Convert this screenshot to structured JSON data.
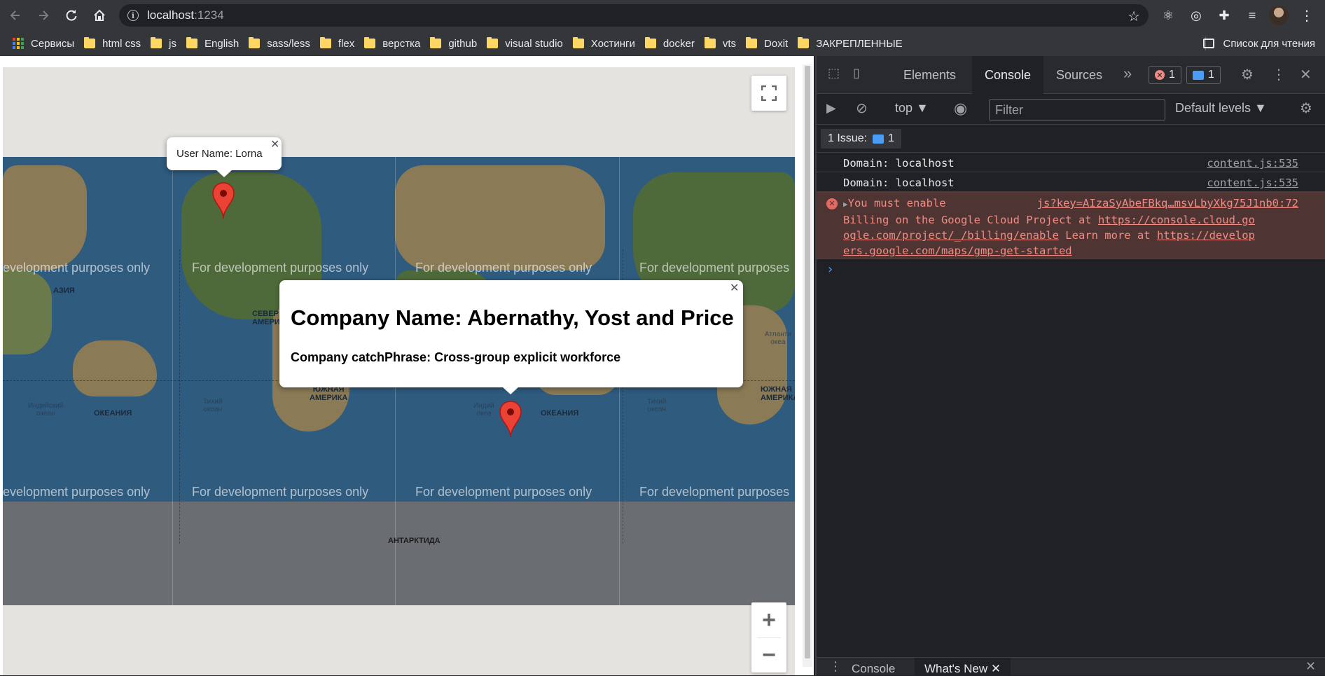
{
  "browser": {
    "url_host": "localhost",
    "url_port": ":1234",
    "bookmarks": [
      "Сервисы",
      "html css",
      "js",
      "English",
      "sass/less",
      "flex",
      "верстка",
      "github",
      "visual studio",
      "Хостинги",
      "docker",
      "vts",
      "Doxit",
      "ЗАКРЕПЛЕННЫЕ"
    ],
    "reading_list": "Список для чтения"
  },
  "map": {
    "watermark": "For development purposes only",
    "watermark_left_cut": "evelopment purposes only",
    "watermark_right_cut": "For development purposes",
    "labels": {
      "asia": "АЗИЯ",
      "north_america": "СЕВЕР\nАМЕРИ",
      "south_america": "ЮЖНАЯ\nАМЕРИКА",
      "south_america_right": "ЮЖНАЯ\nАМЕРИКА",
      "oceania_1": "ОКЕАНИЯ",
      "oceania_2": "ОКЕАНИЯ",
      "antarctica": "АНТАРКТИДА",
      "indian_ocean_1": "Индийский\nокеан",
      "indian_ocean_2": "Индий\nокеа",
      "pacific_1": "Тихий\nокеан",
      "pacific_2": "Тихий\nокеан",
      "atlantic": "Атланти\nокеа"
    },
    "infowindow_small": {
      "text": "User Name: Lorna",
      "close": "✕"
    },
    "infowindow_big": {
      "title": "Company Name: Abernathy, Yost and Price",
      "subtitle": "Company catchPhrase: Cross-group explicit workforce",
      "close": "✕"
    },
    "zoom_in": "+",
    "zoom_out": "−",
    "marker_color": "#ea4335"
  },
  "devtools": {
    "tabs": [
      "Elements",
      "Console",
      "Sources"
    ],
    "active_tab": "Console",
    "more_tabs": "»",
    "error_count": "1",
    "message_count": "1",
    "context": "top ▼",
    "filter_placeholder": "Filter",
    "levels": "Default levels ▼",
    "issues_label": "1 Issue:",
    "issues_count": "1",
    "logs": [
      {
        "text": "Domain: localhost",
        "source": "content.js:535"
      },
      {
        "text": "Domain: localhost",
        "source": "content.js:535"
      }
    ],
    "error": {
      "prefix": "You must enable",
      "source": "js?key=AIzaSyAbeFBkq…msvLbyXkg75J1nb0:72",
      "line2_text": "Billing on the Google Cloud Project at ",
      "line2_link": "https://console.cloud.go",
      "line3_link": "ogle.com/project/_/billing/enable",
      "line3_text": " Learn more at ",
      "line3_link2": "https://develop",
      "line4_link": "ers.google.com/maps/gmp-get-started"
    },
    "prompt": "›",
    "drawer_tabs": [
      "Console",
      "What's New"
    ],
    "drawer_close": "✕",
    "close": "✕"
  }
}
